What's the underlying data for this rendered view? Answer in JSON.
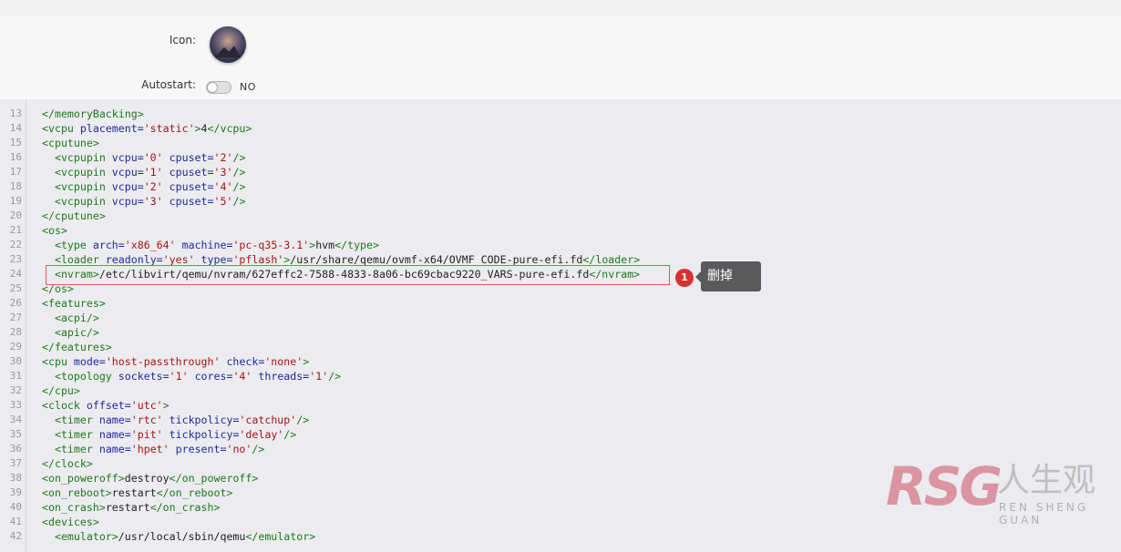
{
  "form": {
    "icon_label": "Icon:",
    "autostart_label": "Autostart:",
    "autostart_value": "NO",
    "autostart_on": false
  },
  "editor": {
    "lines": [
      {
        "n": "13",
        "html": "<span class=\"tg\">&lt;/memoryBacking&gt;</span>"
      },
      {
        "n": "14",
        "html": "<span class=\"tg\">&lt;vcpu</span> <span class=\"at\">placement=</span><span class=\"st\">'static'</span><span class=\"tg\">&gt;</span>4<span class=\"tg\">&lt;/vcpu&gt;</span>"
      },
      {
        "n": "15",
        "html": "<span class=\"tg\">&lt;cputune&gt;</span>"
      },
      {
        "n": "16",
        "html": "  <span class=\"tg\">&lt;vcpupin</span> <span class=\"at\">vcpu=</span><span class=\"st\">'0'</span> <span class=\"at\">cpuset=</span><span class=\"st\">'2'</span><span class=\"tg\">/&gt;</span>"
      },
      {
        "n": "17",
        "html": "  <span class=\"tg\">&lt;vcpupin</span> <span class=\"at\">vcpu=</span><span class=\"st\">'1'</span> <span class=\"at\">cpuset=</span><span class=\"st\">'3'</span><span class=\"tg\">/&gt;</span>"
      },
      {
        "n": "18",
        "html": "  <span class=\"tg\">&lt;vcpupin</span> <span class=\"at\">vcpu=</span><span class=\"st\">'2'</span> <span class=\"at\">cpuset=</span><span class=\"st\">'4'</span><span class=\"tg\">/&gt;</span>"
      },
      {
        "n": "19",
        "html": "  <span class=\"tg\">&lt;vcpupin</span> <span class=\"at\">vcpu=</span><span class=\"st\">'3'</span> <span class=\"at\">cpuset=</span><span class=\"st\">'5'</span><span class=\"tg\">/&gt;</span>"
      },
      {
        "n": "20",
        "html": "<span class=\"tg\">&lt;/cputune&gt;</span>"
      },
      {
        "n": "21",
        "html": "<span class=\"tg\">&lt;os&gt;</span>"
      },
      {
        "n": "22",
        "html": "  <span class=\"tg\">&lt;type</span> <span class=\"at\">arch=</span><span class=\"st\">'x86_64'</span> <span class=\"at\">machine=</span><span class=\"st\">'pc-q35-3.1'</span><span class=\"tg\">&gt;</span>hvm<span class=\"tg\">&lt;/type&gt;</span>"
      },
      {
        "n": "23",
        "html": "  <span class=\"tg\">&lt;loader</span> <span class=\"at\">readonly=</span><span class=\"st\">'yes'</span> <span class=\"at\">type=</span><span class=\"st\">'pflash'</span><span class=\"tg\">&gt;</span>/usr/share/qemu/ovmf-x64/OVMF_CODE-pure-efi.fd<span class=\"tg\">&lt;/loader&gt;</span>"
      },
      {
        "n": "24",
        "html": "  <span class=\"tg\">&lt;nvram&gt;</span>/etc/libvirt/qemu/nvram/627effc2-7588-4833-8a06-bc69cbac9220_VARS-pure-efi.fd<span class=\"tg\">&lt;/nvram&gt;</span>"
      },
      {
        "n": "25",
        "html": "<span class=\"tg\">&lt;/os&gt;</span>"
      },
      {
        "n": "26",
        "html": "<span class=\"tg\">&lt;features&gt;</span>"
      },
      {
        "n": "27",
        "html": "  <span class=\"tg\">&lt;acpi/&gt;</span>"
      },
      {
        "n": "28",
        "html": "  <span class=\"tg\">&lt;apic/&gt;</span>"
      },
      {
        "n": "29",
        "html": "<span class=\"tg\">&lt;/features&gt;</span>"
      },
      {
        "n": "30",
        "html": "<span class=\"tg\">&lt;cpu</span> <span class=\"at\">mode=</span><span class=\"st\">'host-passthrough'</span> <span class=\"at\">check=</span><span class=\"st\">'none'</span><span class=\"tg\">&gt;</span>"
      },
      {
        "n": "31",
        "html": "  <span class=\"tg\">&lt;topology</span> <span class=\"at\">sockets=</span><span class=\"st\">'1'</span> <span class=\"at\">cores=</span><span class=\"st\">'4'</span> <span class=\"at\">threads=</span><span class=\"st\">'1'</span><span class=\"tg\">/&gt;</span>"
      },
      {
        "n": "32",
        "html": "<span class=\"tg\">&lt;/cpu&gt;</span>"
      },
      {
        "n": "33",
        "html": "<span class=\"tg\">&lt;clock</span> <span class=\"at\">offset=</span><span class=\"st\">'utc'</span><span class=\"tg\">&gt;</span>"
      },
      {
        "n": "34",
        "html": "  <span class=\"tg\">&lt;timer</span> <span class=\"at\">name=</span><span class=\"st\">'rtc'</span> <span class=\"at\">tickpolicy=</span><span class=\"st\">'catchup'</span><span class=\"tg\">/&gt;</span>"
      },
      {
        "n": "35",
        "html": "  <span class=\"tg\">&lt;timer</span> <span class=\"at\">name=</span><span class=\"st\">'pit'</span> <span class=\"at\">tickpolicy=</span><span class=\"st\">'delay'</span><span class=\"tg\">/&gt;</span>"
      },
      {
        "n": "36",
        "html": "  <span class=\"tg\">&lt;timer</span> <span class=\"at\">name=</span><span class=\"st\">'hpet'</span> <span class=\"at\">present=</span><span class=\"st\">'no'</span><span class=\"tg\">/&gt;</span>"
      },
      {
        "n": "37",
        "html": "<span class=\"tg\">&lt;/clock&gt;</span>"
      },
      {
        "n": "38",
        "html": "<span class=\"tg\">&lt;on_poweroff&gt;</span>destroy<span class=\"tg\">&lt;/on_poweroff&gt;</span>"
      },
      {
        "n": "39",
        "html": "<span class=\"tg\">&lt;on_reboot&gt;</span>restart<span class=\"tg\">&lt;/on_reboot&gt;</span>"
      },
      {
        "n": "40",
        "html": "<span class=\"tg\">&lt;on_crash&gt;</span>restart<span class=\"tg\">&lt;/on_crash&gt;</span>"
      },
      {
        "n": "41",
        "html": "<span class=\"tg\">&lt;devices&gt;</span>"
      },
      {
        "n": "42",
        "html": "  <span class=\"tg\">&lt;emulator&gt;</span>/usr/local/sbin/qemu<span class=\"tg\">&lt;/emulator&gt;</span>"
      }
    ]
  },
  "annotation": {
    "badge": "1",
    "tooltip": "删掉"
  },
  "watermark": {
    "logo": "RSG",
    "cn": "人生观",
    "en": "REN SHENG GUAN"
  },
  "colors": {
    "tag": "#1a7a1a",
    "attr": "#1d2a9a",
    "string": "#a31515",
    "highlight_border": "#e25b5b",
    "badge": "#d93030"
  }
}
